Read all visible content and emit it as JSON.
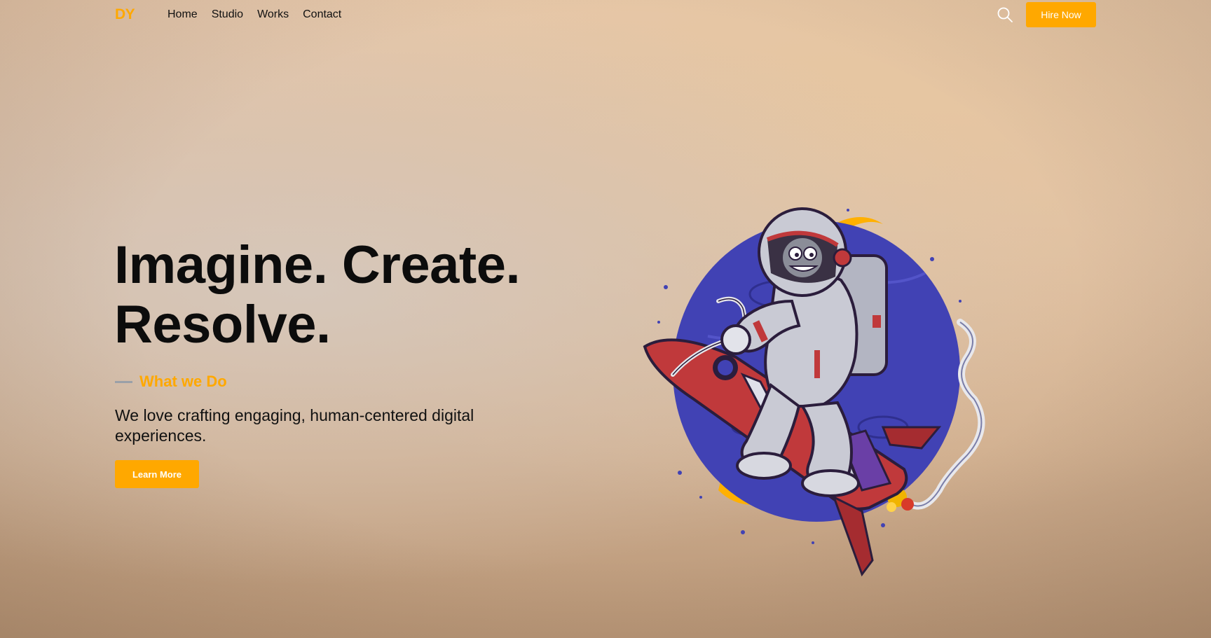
{
  "nav": {
    "logo": "DY",
    "links": [
      "Home",
      "Studio",
      "Works",
      "Contact"
    ],
    "search_icon": "search-icon",
    "hire_label": "Hire Now"
  },
  "hero": {
    "title_line1": "Imagine. Create.",
    "title_line2": "Resolve.",
    "kicker": "What we Do",
    "lead": "We love crafting engaging, human-centered digital experiences.",
    "cta_label": "Learn More",
    "illustration_icon": "astronaut-riding-rocket-illustration"
  },
  "colors": {
    "accent": "#ffa800",
    "text": "#0c0c0c",
    "planet": "#3e3fb0"
  }
}
